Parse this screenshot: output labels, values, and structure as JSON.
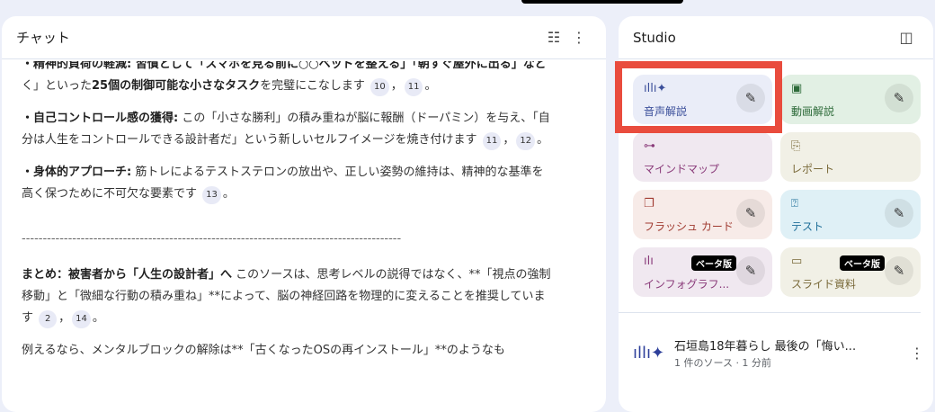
{
  "chat": {
    "title": "チャット",
    "clipped_line": "・精神的負荷の軽減: 習慣として「スマホを見る前に○○ベッドを整える」「朝すぐ屋外に出る」など",
    "p1": {
      "pre": "く」といった",
      "bold": "25個の制御可能な小さなタスク",
      "post": "を完璧にこなします",
      "cites": [
        "10",
        "11"
      ]
    },
    "p2": {
      "bold": "・自己コントロール感の獲得:",
      "text": " この「小さな勝利」の積み重ねが脳に報酬（ドーパミン）を与え、「自分は人生をコントロールできる設計者だ」という新しいセルフイメージを焼き付けます",
      "cites": [
        "11",
        "12"
      ]
    },
    "p3": {
      "bold": "・身体的アプローチ:",
      "text": " 筋トレによるテストステロンの放出や、正しい姿勢の維持は、精神的な基準を高く保つために不可欠な要素です",
      "cites": [
        "13"
      ]
    },
    "divider": "------------------------------------------------------------------------------------------",
    "p4": {
      "bold": "まとめ：被害者から「人生の設計者」へ",
      "text": " このソースは、思考レベルの説得ではなく、**「視点の強制移動」と「微細な行動の積み重ね」**によって、脳の神経回路を物理的に変えることを推奨しています",
      "cites": [
        "2",
        "14"
      ]
    },
    "p5": "例えるなら、メンタルブロックの解除は**「古くなったOSの再インストール」**のようなも",
    "sep": "，",
    "end": "。"
  },
  "studio": {
    "title": "Studio",
    "cards": [
      {
        "label": "音声解説",
        "icon": "audio-sparkle-icon",
        "bg": "#eaedf8",
        "color": "#3b4f9a",
        "pen": true
      },
      {
        "label": "動画解説",
        "icon": "video-icon",
        "bg": "#e2f0e4",
        "color": "#2e6b3a",
        "pen": true
      },
      {
        "label": "マインドマップ",
        "icon": "mindmap-icon",
        "bg": "#f0e8f0",
        "color": "#8a3b7a",
        "pen": false
      },
      {
        "label": "レポート",
        "icon": "report-icon",
        "bg": "#f1f0e6",
        "color": "#7a6a3a",
        "pen": false
      },
      {
        "label": "フラッシュ カード",
        "icon": "flashcard-icon",
        "bg": "#f7ebe8",
        "color": "#a03a30",
        "pen": true
      },
      {
        "label": "テスト",
        "icon": "quiz-icon",
        "bg": "#dff0f6",
        "color": "#1f6f99",
        "pen": true
      },
      {
        "label": "インフォグラフ...",
        "icon": "infographic-icon",
        "bg": "#f0e8f0",
        "color": "#8a3b7a",
        "pen": true,
        "badge": "ベータ版"
      },
      {
        "label": "スライド資料",
        "icon": "slides-icon",
        "bg": "#f1f0e6",
        "color": "#7a6a3a",
        "pen": true,
        "badge": "ベータ版"
      }
    ],
    "item": {
      "title": "石垣島18年暮らし 最後の「悔い...",
      "subtitle": "1 件のソース · 1 分前"
    }
  }
}
